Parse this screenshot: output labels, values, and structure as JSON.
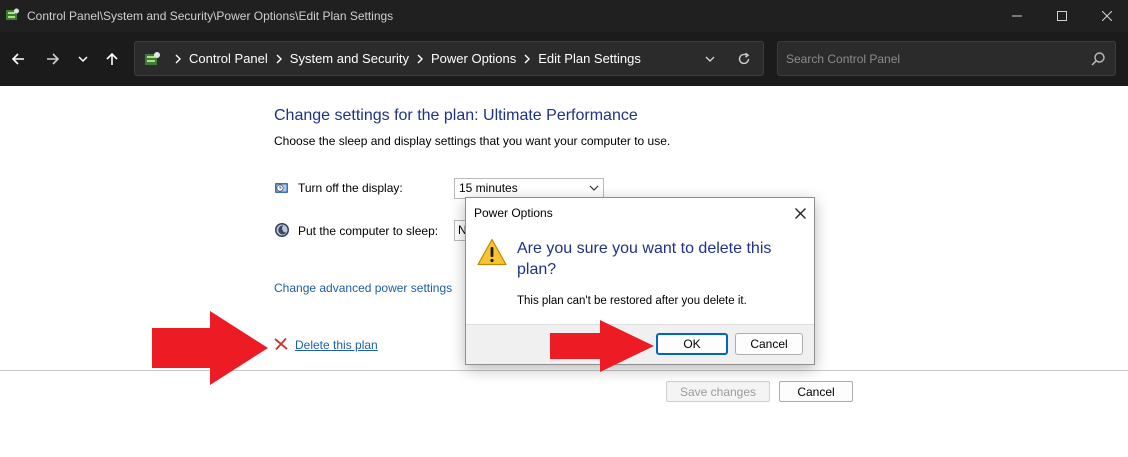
{
  "window": {
    "title": "Control Panel\\System and Security\\Power Options\\Edit Plan Settings"
  },
  "address_bar": {
    "breadcrumbs": [
      "Control Panel",
      "System and Security",
      "Power Options",
      "Edit Plan Settings"
    ]
  },
  "search": {
    "placeholder": "Search Control Panel"
  },
  "main": {
    "heading": "Change settings for the plan: Ultimate Performance",
    "subtext": "Choose the sleep and display settings that you want your computer to use.",
    "settings": [
      {
        "label": "Turn off the display:",
        "value": "15 minutes",
        "icon": "display-timer-icon"
      },
      {
        "label": "Put the computer to sleep:",
        "value": "N",
        "icon": "sleep-moon-icon"
      }
    ],
    "advanced_link": "Change advanced power settings",
    "delete_link": "Delete this plan",
    "save_label": "Save changes",
    "cancel_label": "Cancel"
  },
  "dialog": {
    "title": "Power Options",
    "question": "Are you sure you want to delete this plan?",
    "note": "This plan can't be restored after you delete it.",
    "ok_label": "OK",
    "cancel_label": "Cancel",
    "icon": "warning-icon"
  },
  "colors": {
    "titlebar_bg": "#202020",
    "addressbar_bg": "#1b1b1b",
    "heading_blue": "#1e3287",
    "link_blue": "#1e5ea8",
    "annotation_red": "#ed1c24",
    "focus_blue": "#0067c0"
  }
}
